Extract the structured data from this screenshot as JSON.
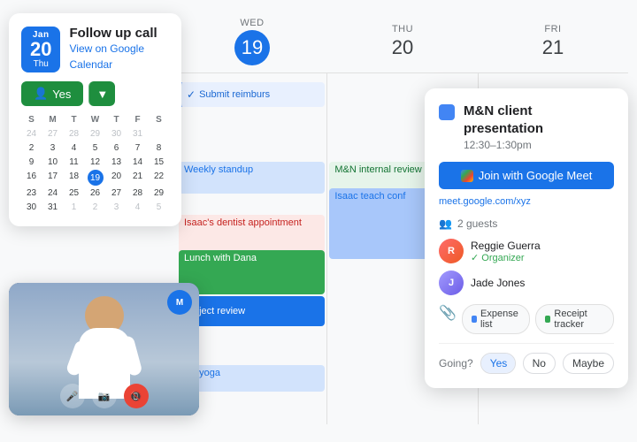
{
  "calendar": {
    "days": [
      {
        "name": "WED",
        "number": "19",
        "today": true
      },
      {
        "name": "THU",
        "number": "20",
        "today": false
      },
      {
        "name": "FRI",
        "number": "21",
        "today": false
      }
    ],
    "events": {
      "wed": {
        "submit": "Submit reimburs",
        "weekly": "Weekly standup",
        "isaacDentist": "Isaac's dentist appointment",
        "lunch": "Lunch with Dana",
        "project": "Project review",
        "yoga": "Do yoga"
      },
      "thu": {
        "mnInternal": "M&N internal review",
        "isaacConf": "Isaac teach conf"
      }
    }
  },
  "notification_card": {
    "month": "Jan",
    "day": "20",
    "weekday": "Thu",
    "event_title": "Follow up call",
    "calendar_link": "View on Google Calendar",
    "yes_label": "Yes",
    "yes_icon": "👤"
  },
  "mini_calendar": {
    "headers": [
      "S",
      "M",
      "T",
      "W",
      "T",
      "F",
      "S"
    ],
    "rows": [
      [
        "24",
        "27",
        "28",
        "29",
        "30",
        "31",
        ""
      ],
      [
        "2",
        "3",
        "4",
        "5",
        "6",
        "7",
        "8"
      ],
      [
        "9",
        "10",
        "11",
        "12",
        "13",
        "14",
        "15"
      ],
      [
        "16",
        "17",
        "18",
        "19",
        "20",
        "21",
        "22"
      ],
      [
        "23",
        "24",
        "25",
        "26",
        "27",
        "28",
        "29"
      ],
      [
        "30",
        "31",
        "1",
        "2",
        "3",
        "4",
        "5"
      ]
    ],
    "today_cell": "19"
  },
  "event_popup": {
    "title": "M&N client presentation",
    "time": "12:30–1:30pm",
    "join_label": "Join with Google Meet",
    "meet_link": "meet.google.com/xyz",
    "guests_count": "2 guests",
    "guests": [
      {
        "name": "Reggie Guerra",
        "role": "Organizer"
      },
      {
        "name": "Jade Jones",
        "role": ""
      }
    ],
    "attachments": [
      {
        "label": "Expense list",
        "color": "#4285f4"
      },
      {
        "label": "Receipt tracker",
        "color": "#34a853"
      }
    ],
    "going_label": "Going?",
    "rsvp_yes": "Yes",
    "rsvp_no": "No",
    "rsvp_maybe": "Maybe"
  },
  "video_call": {
    "controls": {
      "mic": "🎤",
      "camera": "📷",
      "hangup": "📵"
    }
  },
  "colors": {
    "blue": "#1a73e8",
    "green": "#34a853",
    "red": "#ea4335",
    "yellow": "#fbbc05",
    "light_blue_event": "#d2e3fc",
    "light_green_event": "#e6f4ea",
    "light_red_event": "#fce8e6"
  }
}
